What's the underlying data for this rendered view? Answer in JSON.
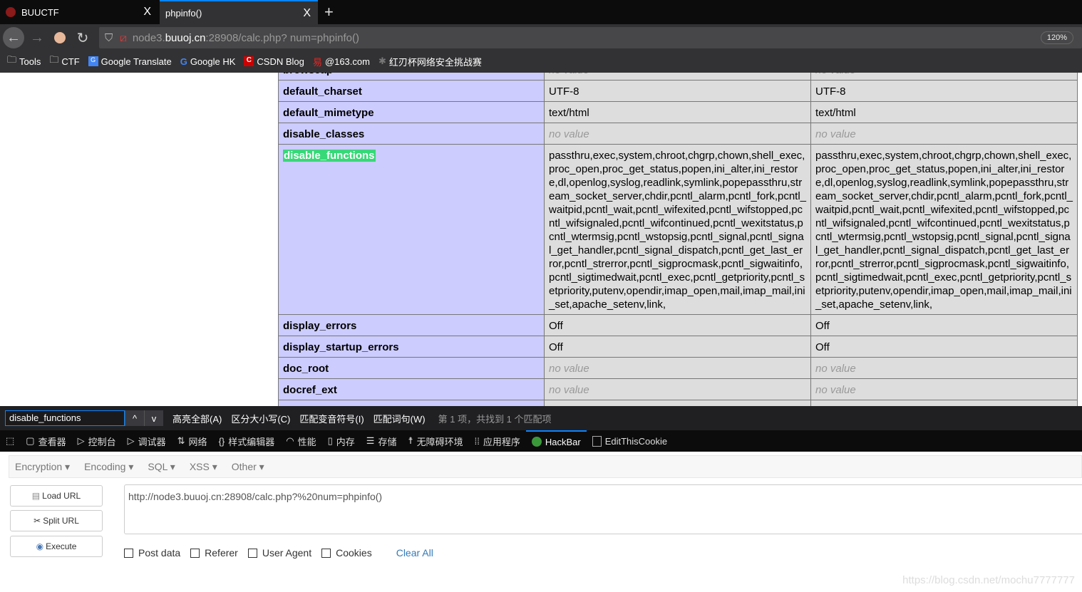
{
  "tabs": [
    {
      "label": "BUUCTF",
      "close": "X"
    },
    {
      "label": "phpinfo()",
      "close": "X",
      "active": true
    }
  ],
  "new_tab": "+",
  "url": {
    "prefix": "node3.",
    "host": "buuoj.cn",
    "rest": ":28908/calc.php? num=phpinfo()"
  },
  "zoom": "120%",
  "bookmarks": [
    {
      "label": "Tools",
      "icon": "folder-icon"
    },
    {
      "label": "CTF",
      "icon": "folder-icon"
    },
    {
      "label": "Google Translate",
      "icon": "google-translate-icon"
    },
    {
      "label": "Google HK",
      "icon": "google-icon"
    },
    {
      "label": "CSDN Blog",
      "icon": "csdn-icon"
    },
    {
      "label": "@163.com",
      "icon": "netease-icon"
    },
    {
      "label": "红刃杯网络安全挑战赛",
      "icon": "paw-icon"
    }
  ],
  "table": {
    "top_partial": {
      "name": "browscap",
      "local": "no value",
      "master": "no value"
    },
    "rows": [
      {
        "name": "default_charset",
        "local": "UTF-8",
        "master": "UTF-8"
      },
      {
        "name": "default_mimetype",
        "local": "text/html",
        "master": "text/html"
      },
      {
        "name": "disable_classes",
        "local": "no value",
        "master": "no value",
        "novalue": true
      },
      {
        "name": "disable_functions",
        "highlight": true,
        "local": "passthru,exec,system,chroot,chgrp,chown,shell_exec,proc_open,proc_get_status,popen,ini_alter,ini_restore,dl,openlog,syslog,readlink,symlink,popepassthru,stream_socket_server,chdir,pcntl_alarm,pcntl_fork,pcntl_waitpid,pcntl_wait,pcntl_wifexited,pcntl_wifstopped,pcntl_wifsignaled,pcntl_wifcontinued,pcntl_wexitstatus,pcntl_wtermsig,pcntl_wstopsig,pcntl_signal,pcntl_signal_get_handler,pcntl_signal_dispatch,pcntl_get_last_error,pcntl_strerror,pcntl_sigprocmask,pcntl_sigwaitinfo,pcntl_sigtimedwait,pcntl_exec,pcntl_getpriority,pcntl_setpriority,putenv,opendir,imap_open,mail,imap_mail,ini_set,apache_setenv,link,",
        "master": "passthru,exec,system,chroot,chgrp,chown,shell_exec,proc_open,proc_get_status,popen,ini_alter,ini_restore,dl,openlog,syslog,readlink,symlink,popepassthru,stream_socket_server,chdir,pcntl_alarm,pcntl_fork,pcntl_waitpid,pcntl_wait,pcntl_wifexited,pcntl_wifstopped,pcntl_wifsignaled,pcntl_wifcontinued,pcntl_wexitstatus,pcntl_wtermsig,pcntl_wstopsig,pcntl_signal,pcntl_signal_get_handler,pcntl_signal_dispatch,pcntl_get_last_error,pcntl_strerror,pcntl_sigprocmask,pcntl_sigwaitinfo,pcntl_sigtimedwait,pcntl_exec,pcntl_getpriority,pcntl_setpriority,putenv,opendir,imap_open,mail,imap_mail,ini_set,apache_setenv,link,"
      },
      {
        "name": "display_errors",
        "local": "Off",
        "master": "Off"
      },
      {
        "name": "display_startup_errors",
        "local": "Off",
        "master": "Off"
      },
      {
        "name": "doc_root",
        "local": "no value",
        "master": "no value",
        "novalue": true
      },
      {
        "name": "docref_ext",
        "local": "no value",
        "master": "no value",
        "novalue": true
      }
    ]
  },
  "findbar": {
    "query": "disable_functions",
    "up": "^",
    "down": "v",
    "highlight_all": "高亮全部(A)",
    "match_case": "区分大小写(C)",
    "match_diacritics": "匹配变音符号(I)",
    "whole_words": "匹配词句(W)",
    "status": "第 1 项，共找到 1 个匹配项"
  },
  "devtools": [
    {
      "label": "查看器",
      "icon": "inspector-icon"
    },
    {
      "label": "控制台",
      "icon": "console-icon"
    },
    {
      "label": "调试器",
      "icon": "debugger-icon"
    },
    {
      "label": "网络",
      "icon": "network-icon"
    },
    {
      "label": "样式编辑器",
      "icon": "style-editor-icon"
    },
    {
      "label": "性能",
      "icon": "performance-icon"
    },
    {
      "label": "内存",
      "icon": "memory-icon"
    },
    {
      "label": "存储",
      "icon": "storage-icon"
    },
    {
      "label": "无障碍环境",
      "icon": "accessibility-icon"
    },
    {
      "label": "应用程序",
      "icon": "application-icon"
    },
    {
      "label": "HackBar",
      "icon": "hackbar-icon",
      "active": true
    },
    {
      "label": "EditThisCookie",
      "icon": "cookie-icon"
    }
  ],
  "hackbar": {
    "menu": [
      "Encryption",
      "Encoding",
      "SQL",
      "XSS",
      "Other"
    ],
    "load_url": "Load URL",
    "split_url": "Split URL",
    "execute": "Execute",
    "url_value": "http://node3.buuoj.cn:28908/calc.php?%20num=phpinfo()",
    "checks": [
      "Post data",
      "Referer",
      "User Agent",
      "Cookies"
    ],
    "clear_all": "Clear All"
  },
  "watermark": "https://blog.csdn.net/mochu7777777"
}
